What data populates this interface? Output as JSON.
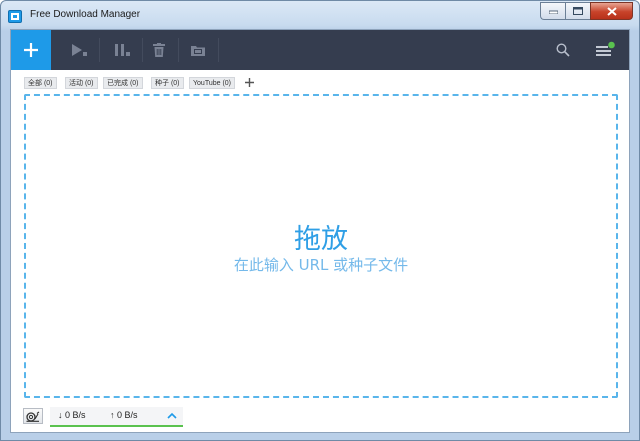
{
  "window": {
    "title": "Free Download Manager"
  },
  "toolbar": {
    "add_icon": "plus-icon",
    "buttons": [
      "resume-icon",
      "pause-icon",
      "delete-icon",
      "move-icon"
    ],
    "search_icon": "search-icon",
    "menu_icon": "menu-icon",
    "colors": {
      "toolbar_bg": "#353d4f",
      "accent": "#1e9ae8",
      "notify": "#5ac24f"
    }
  },
  "tabs": [
    {
      "label": "全部 (0)"
    },
    {
      "label": "活动 (0)"
    },
    {
      "label": "已完成 (0)"
    },
    {
      "label": "种子 (0)"
    },
    {
      "label": "YouTube (0)"
    }
  ],
  "dropzone": {
    "title": "拖放",
    "subtitle": "在此输入 URL 或种子文件"
  },
  "status": {
    "download_speed": "0 B/s",
    "upload_speed": "0 B/s"
  }
}
